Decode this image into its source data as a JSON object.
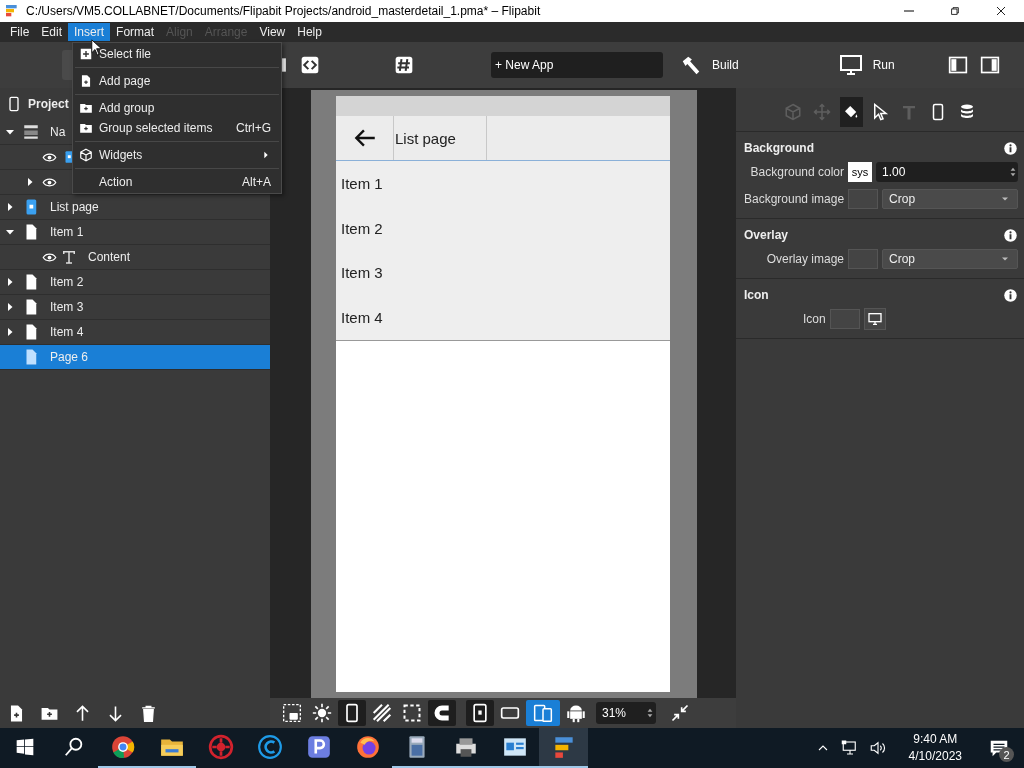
{
  "window": {
    "title": "C:/Users/VM5.COLLABNET/Documents/Flipabit Projects/android_masterdetail_1.pma* – Flipabit"
  },
  "menu_bar": [
    {
      "label": "File",
      "selected": false,
      "disabled": false
    },
    {
      "label": "Edit",
      "selected": false,
      "disabled": false
    },
    {
      "label": "Insert",
      "selected": true,
      "disabled": false
    },
    {
      "label": "Format",
      "selected": false,
      "disabled": false
    },
    {
      "label": "Align",
      "selected": false,
      "disabled": true
    },
    {
      "label": "Arrange",
      "selected": false,
      "disabled": true
    },
    {
      "label": "View",
      "selected": false,
      "disabled": false
    },
    {
      "label": "Help",
      "selected": false,
      "disabled": false
    }
  ],
  "insert_menu": [
    [
      {
        "kind": "file",
        "label": "Select file"
      }
    ],
    [
      {
        "kind": "page",
        "label": "Add page"
      }
    ],
    [
      {
        "kind": "folder",
        "label": "Add group"
      },
      {
        "kind": "folder",
        "label": "Group selected items",
        "shortcut": "Ctrl+G"
      }
    ],
    [
      {
        "kind": "cube",
        "label": "Widgets",
        "submenu": true
      }
    ],
    [
      {
        "kind": "none",
        "label": "Action",
        "shortcut": "Alt+A"
      }
    ]
  ],
  "toolbar": {
    "new_app": "+ New App",
    "build": "Build",
    "run": "Run"
  },
  "project": {
    "title": "Project",
    "tree": [
      {
        "kind": "nav",
        "label": "Na",
        "expanded": true,
        "selected": false,
        "children": [
          {
            "kind": "component",
            "eye": true,
            "selected": false
          },
          {
            "kind": "blank",
            "eye": true,
            "expanded": false,
            "selected": false
          }
        ]
      },
      {
        "kind": "component",
        "label": "List page",
        "expanded": false,
        "selected": false
      },
      {
        "kind": "page",
        "label": "Item 1",
        "expanded": true,
        "selected": false,
        "children": [
          {
            "kind": "text",
            "label": "Content",
            "eye": true,
            "selected": false
          }
        ]
      },
      {
        "kind": "page",
        "label": "Item 2",
        "expanded": false,
        "selected": false
      },
      {
        "kind": "page",
        "label": "Item 3",
        "expanded": false,
        "selected": false
      },
      {
        "kind": "page",
        "label": "Item 4",
        "expanded": false,
        "selected": false
      },
      {
        "kind": "page",
        "label": "Page 6",
        "selected": true
      }
    ]
  },
  "left_tools": [
    {
      "kind": "newpage"
    },
    {
      "kind": "newfolder"
    },
    {
      "kind": "up"
    },
    {
      "kind": "down"
    },
    {
      "kind": "trash"
    }
  ],
  "preview": {
    "title": "List page",
    "items": [
      "Item 1",
      "Item 2",
      "Item 3",
      "Item 4"
    ]
  },
  "canvas_tools": [
    {
      "kind": "camera",
      "selected": false
    },
    {
      "kind": "sun",
      "selected": false
    },
    {
      "kind": "phone",
      "selected": true
    },
    {
      "kind": "hatch",
      "selected": false
    },
    {
      "kind": "marquee",
      "selected": false
    },
    {
      "kind": "magnet",
      "selected": true
    },
    {
      "kind": "portrait",
      "selected": true
    },
    {
      "kind": "landscape",
      "selected": false
    },
    {
      "kind": "devices",
      "selected": true
    },
    {
      "kind": "android",
      "selected": false
    }
  ],
  "zoom": "31%",
  "inspector": {
    "tabs": [
      {
        "kind": "cube",
        "selected": false,
        "disabled": true
      },
      {
        "kind": "move",
        "selected": false,
        "disabled": true
      },
      {
        "kind": "bucket",
        "selected": true,
        "disabled": false
      },
      {
        "kind": "cursor",
        "selected": false,
        "disabled": false
      },
      {
        "kind": "text",
        "selected": false,
        "disabled": true
      },
      {
        "kind": "phone",
        "selected": false,
        "disabled": false
      },
      {
        "kind": "database",
        "selected": false,
        "disabled": false
      }
    ],
    "sections": [
      {
        "title": "Background",
        "rows": [
          {
            "kind": "color",
            "label": "Background color",
            "swatch": "sys",
            "value": "1.00"
          },
          {
            "kind": "image",
            "label": "Background image",
            "option": "Crop"
          }
        ]
      },
      {
        "title": "Overlay",
        "rows": [
          {
            "kind": "image",
            "label": "Overlay image",
            "option": "Crop"
          }
        ]
      },
      {
        "title": "Icon",
        "rows": [
          {
            "kind": "icon",
            "label": "Icon"
          }
        ]
      }
    ]
  },
  "taskbar": {
    "apps": [
      {
        "kind": "chrome",
        "running": true,
        "active": false
      },
      {
        "kind": "folder",
        "running": true,
        "active": false
      },
      {
        "kind": "red",
        "running": false,
        "active": false
      },
      {
        "kind": "c",
        "running": false,
        "active": false
      },
      {
        "kind": "p",
        "running": false,
        "active": false
      },
      {
        "kind": "firefox",
        "running": false,
        "active": false
      },
      {
        "kind": "calculator",
        "running": true,
        "active": false
      },
      {
        "kind": "printer",
        "running": true,
        "active": false
      },
      {
        "kind": "screen",
        "running": true,
        "active": false
      },
      {
        "kind": "flipabit",
        "running": true,
        "active": true
      }
    ],
    "time": "9:40 AM",
    "date": "4/10/2023",
    "notifications": "2"
  }
}
